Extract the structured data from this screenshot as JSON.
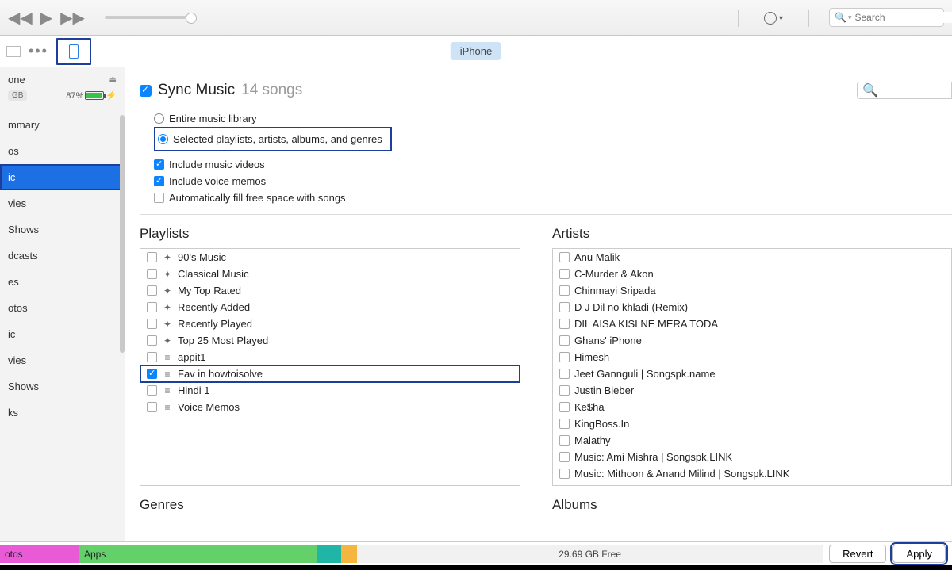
{
  "titlebar": {
    "search_placeholder": "Search"
  },
  "toolbar": {
    "tab_label": "iPhone"
  },
  "sidebar": {
    "device_name": "one",
    "capacity": "GB",
    "battery_pct": "87%",
    "items": [
      "mmary",
      "os",
      "ic",
      "vies",
      "Shows",
      "dcasts",
      "es",
      "otos",
      "ic",
      "vies",
      "Shows",
      "ks"
    ],
    "active_index": 2
  },
  "sync": {
    "title": "Sync Music",
    "song_count": "14 songs",
    "radio_entire": "Entire music library",
    "radio_selected": "Selected playlists, artists, albums, and genres",
    "chk_videos": "Include music videos",
    "chk_memos": "Include voice memos",
    "chk_autofill": "Automatically fill free space with songs"
  },
  "headers": {
    "playlists": "Playlists",
    "artists": "Artists",
    "genres": "Genres",
    "albums": "Albums"
  },
  "playlists": [
    {
      "label": "90's Music",
      "smart": true,
      "checked": false
    },
    {
      "label": "Classical Music",
      "smart": true,
      "checked": false
    },
    {
      "label": "My Top Rated",
      "smart": true,
      "checked": false
    },
    {
      "label": "Recently Added",
      "smart": true,
      "checked": false
    },
    {
      "label": "Recently Played",
      "smart": true,
      "checked": false
    },
    {
      "label": "Top 25 Most Played",
      "smart": true,
      "checked": false
    },
    {
      "label": "appit1",
      "smart": false,
      "checked": false
    },
    {
      "label": "Fav in howtoisolve",
      "smart": false,
      "checked": true,
      "boxed": true
    },
    {
      "label": "Hindi 1",
      "smart": false,
      "checked": false
    },
    {
      "label": "Voice Memos",
      "smart": false,
      "checked": false
    }
  ],
  "artists": [
    "Anu Malik",
    "C-Murder & Akon",
    "Chinmayi Sripada",
    "D J Dil no khladi (Remix)",
    "DIL AISA KISI NE MERA TODA",
    "Ghans' iPhone",
    "Himesh",
    "Jeet Gannguli | Songspk.name",
    "Justin Bieber",
    "Ke$ha",
    "KingBoss.In",
    "Malathy",
    "Music: Ami Mishra | Songspk.LINK",
    "Music: Mithoon & Anand Milind | Songspk.LINK"
  ],
  "storage": {
    "photos": "otos",
    "apps": "Apps",
    "free": "29.69 GB Free",
    "revert": "Revert",
    "apply": "Apply"
  }
}
